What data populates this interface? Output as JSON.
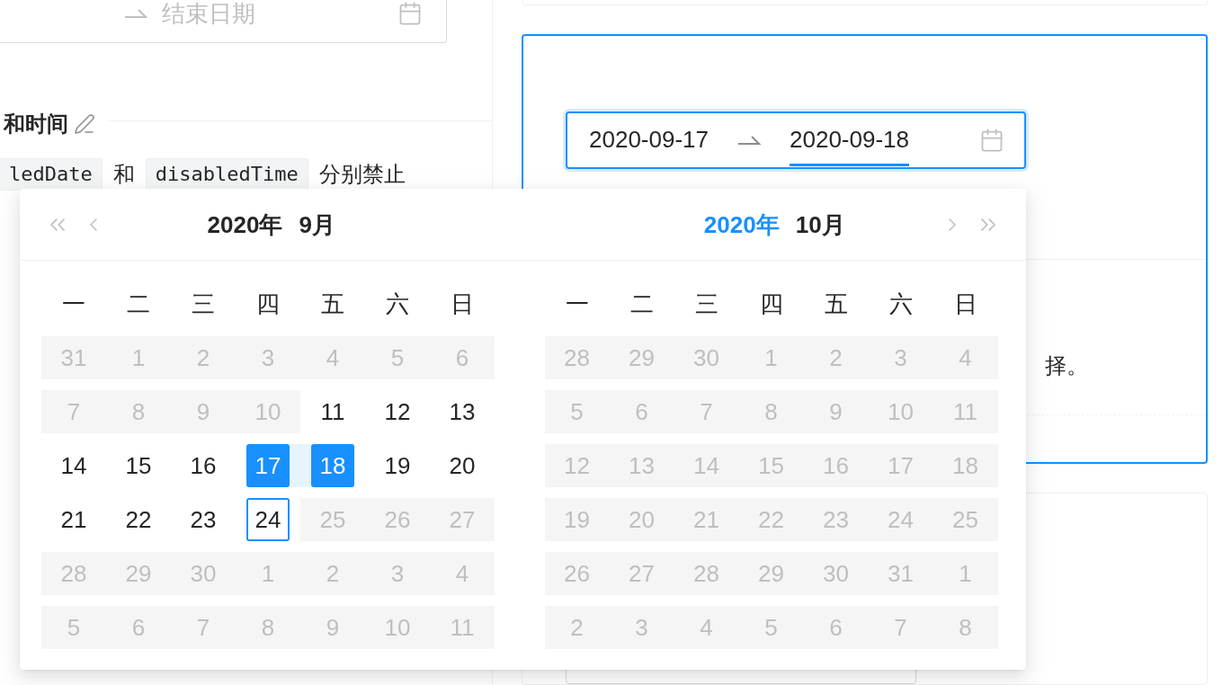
{
  "left_column": {
    "date_input": {
      "end_placeholder": "结束日期"
    },
    "section_heading": "和时间",
    "paragraph": [
      {
        "kind": "code",
        "text": "ledDate"
      },
      {
        "kind": "text",
        "text": "和"
      },
      {
        "kind": "code",
        "text": "disabledTime"
      },
      {
        "kind": "text",
        "text": "分别禁止"
      }
    ]
  },
  "right_column": {
    "range_picker": {
      "focused": true,
      "inputs": [
        {
          "value": "2020-09-17",
          "active": false
        },
        {
          "value": "2020-09-18",
          "active": true
        }
      ]
    },
    "description_tail": "择。"
  },
  "popup": {
    "panels": [
      {
        "has_prev_nav": true,
        "has_next_nav": false,
        "year": "2020年",
        "year_hovered": false,
        "month": "9月",
        "weekdays": [
          "一",
          "二",
          "三",
          "四",
          "五",
          "六",
          "日"
        ],
        "weeks": [
          [
            {
              "day": "31",
              "disabled": true,
              "selected": false,
              "today": false
            },
            {
              "day": "1",
              "disabled": true,
              "selected": false,
              "today": false
            },
            {
              "day": "2",
              "disabled": true,
              "selected": false,
              "today": false
            },
            {
              "day": "3",
              "disabled": true,
              "selected": false,
              "today": false
            },
            {
              "day": "4",
              "disabled": true,
              "selected": false,
              "today": false
            },
            {
              "day": "5",
              "disabled": true,
              "selected": false,
              "today": false
            },
            {
              "day": "6",
              "disabled": true,
              "selected": false,
              "today": false
            }
          ],
          [
            {
              "day": "7",
              "disabled": true,
              "selected": false,
              "today": false
            },
            {
              "day": "8",
              "disabled": true,
              "selected": false,
              "today": false
            },
            {
              "day": "9",
              "disabled": true,
              "selected": false,
              "today": false
            },
            {
              "day": "10",
              "disabled": true,
              "selected": false,
              "today": false
            },
            {
              "day": "11",
              "disabled": false,
              "selected": false,
              "today": false
            },
            {
              "day": "12",
              "disabled": false,
              "selected": false,
              "today": false
            },
            {
              "day": "13",
              "disabled": false,
              "selected": false,
              "today": false
            }
          ],
          [
            {
              "day": "14",
              "disabled": false,
              "selected": false,
              "today": false
            },
            {
              "day": "15",
              "disabled": false,
              "selected": false,
              "today": false
            },
            {
              "day": "16",
              "disabled": false,
              "selected": false,
              "today": false
            },
            {
              "day": "17",
              "disabled": false,
              "selected": true,
              "today": false
            },
            {
              "day": "18",
              "disabled": false,
              "selected": true,
              "today": false
            },
            {
              "day": "19",
              "disabled": false,
              "selected": false,
              "today": false
            },
            {
              "day": "20",
              "disabled": false,
              "selected": false,
              "today": false
            }
          ],
          [
            {
              "day": "21",
              "disabled": false,
              "selected": false,
              "today": false
            },
            {
              "day": "22",
              "disabled": false,
              "selected": false,
              "today": false
            },
            {
              "day": "23",
              "disabled": false,
              "selected": false,
              "today": false
            },
            {
              "day": "24",
              "disabled": false,
              "selected": false,
              "today": true
            },
            {
              "day": "25",
              "disabled": true,
              "selected": false,
              "today": false
            },
            {
              "day": "26",
              "disabled": true,
              "selected": false,
              "today": false
            },
            {
              "day": "27",
              "disabled": true,
              "selected": false,
              "today": false
            }
          ],
          [
            {
              "day": "28",
              "disabled": true,
              "selected": false,
              "today": false
            },
            {
              "day": "29",
              "disabled": true,
              "selected": false,
              "today": false
            },
            {
              "day": "30",
              "disabled": true,
              "selected": false,
              "today": false
            },
            {
              "day": "1",
              "disabled": true,
              "selected": false,
              "today": false
            },
            {
              "day": "2",
              "disabled": true,
              "selected": false,
              "today": false
            },
            {
              "day": "3",
              "disabled": true,
              "selected": false,
              "today": false
            },
            {
              "day": "4",
              "disabled": true,
              "selected": false,
              "today": false
            }
          ],
          [
            {
              "day": "5",
              "disabled": true,
              "selected": false,
              "today": false
            },
            {
              "day": "6",
              "disabled": true,
              "selected": false,
              "today": false
            },
            {
              "day": "7",
              "disabled": true,
              "selected": false,
              "today": false
            },
            {
              "day": "8",
              "disabled": true,
              "selected": false,
              "today": false
            },
            {
              "day": "9",
              "disabled": true,
              "selected": false,
              "today": false
            },
            {
              "day": "10",
              "disabled": true,
              "selected": false,
              "today": false
            },
            {
              "day": "11",
              "disabled": true,
              "selected": false,
              "today": false
            }
          ]
        ]
      },
      {
        "has_prev_nav": false,
        "has_next_nav": true,
        "year": "2020年",
        "year_hovered": true,
        "month": "10月",
        "weekdays": [
          "一",
          "二",
          "三",
          "四",
          "五",
          "六",
          "日"
        ],
        "weeks": [
          [
            {
              "day": "28",
              "disabled": true,
              "selected": false,
              "today": false
            },
            {
              "day": "29",
              "disabled": true,
              "selected": false,
              "today": false
            },
            {
              "day": "30",
              "disabled": true,
              "selected": false,
              "today": false
            },
            {
              "day": "1",
              "disabled": true,
              "selected": false,
              "today": false
            },
            {
              "day": "2",
              "disabled": true,
              "selected": false,
              "today": false
            },
            {
              "day": "3",
              "disabled": true,
              "selected": false,
              "today": false
            },
            {
              "day": "4",
              "disabled": true,
              "selected": false,
              "today": false
            }
          ],
          [
            {
              "day": "5",
              "disabled": true,
              "selected": false,
              "today": false
            },
            {
              "day": "6",
              "disabled": true,
              "selected": false,
              "today": false
            },
            {
              "day": "7",
              "disabled": true,
              "selected": false,
              "today": false
            },
            {
              "day": "8",
              "disabled": true,
              "selected": false,
              "today": false
            },
            {
              "day": "9",
              "disabled": true,
              "selected": false,
              "today": false
            },
            {
              "day": "10",
              "disabled": true,
              "selected": false,
              "today": false
            },
            {
              "day": "11",
              "disabled": true,
              "selected": false,
              "today": false
            }
          ],
          [
            {
              "day": "12",
              "disabled": true,
              "selected": false,
              "today": false
            },
            {
              "day": "13",
              "disabled": true,
              "selected": false,
              "today": false
            },
            {
              "day": "14",
              "disabled": true,
              "selected": false,
              "today": false
            },
            {
              "day": "15",
              "disabled": true,
              "selected": false,
              "today": false
            },
            {
              "day": "16",
              "disabled": true,
              "selected": false,
              "today": false
            },
            {
              "day": "17",
              "disabled": true,
              "selected": false,
              "today": false
            },
            {
              "day": "18",
              "disabled": true,
              "selected": false,
              "today": false
            }
          ],
          [
            {
              "day": "19",
              "disabled": true,
              "selected": false,
              "today": false
            },
            {
              "day": "20",
              "disabled": true,
              "selected": false,
              "today": false
            },
            {
              "day": "21",
              "disabled": true,
              "selected": false,
              "today": false
            },
            {
              "day": "22",
              "disabled": true,
              "selected": false,
              "today": false
            },
            {
              "day": "23",
              "disabled": true,
              "selected": false,
              "today": false
            },
            {
              "day": "24",
              "disabled": true,
              "selected": false,
              "today": false
            },
            {
              "day": "25",
              "disabled": true,
              "selected": false,
              "today": false
            }
          ],
          [
            {
              "day": "26",
              "disabled": true,
              "selected": false,
              "today": false
            },
            {
              "day": "27",
              "disabled": true,
              "selected": false,
              "today": false
            },
            {
              "day": "28",
              "disabled": true,
              "selected": false,
              "today": false
            },
            {
              "day": "29",
              "disabled": true,
              "selected": false,
              "today": false
            },
            {
              "day": "30",
              "disabled": true,
              "selected": false,
              "today": false
            },
            {
              "day": "31",
              "disabled": true,
              "selected": false,
              "today": false
            },
            {
              "day": "1",
              "disabled": true,
              "selected": false,
              "today": false
            }
          ],
          [
            {
              "day": "2",
              "disabled": true,
              "selected": false,
              "today": false
            },
            {
              "day": "3",
              "disabled": true,
              "selected": false,
              "today": false
            },
            {
              "day": "4",
              "disabled": true,
              "selected": false,
              "today": false
            },
            {
              "day": "5",
              "disabled": true,
              "selected": false,
              "today": false
            },
            {
              "day": "6",
              "disabled": true,
              "selected": false,
              "today": false
            },
            {
              "day": "7",
              "disabled": true,
              "selected": false,
              "today": false
            },
            {
              "day": "8",
              "disabled": true,
              "selected": false,
              "today": false
            }
          ]
        ]
      }
    ]
  }
}
